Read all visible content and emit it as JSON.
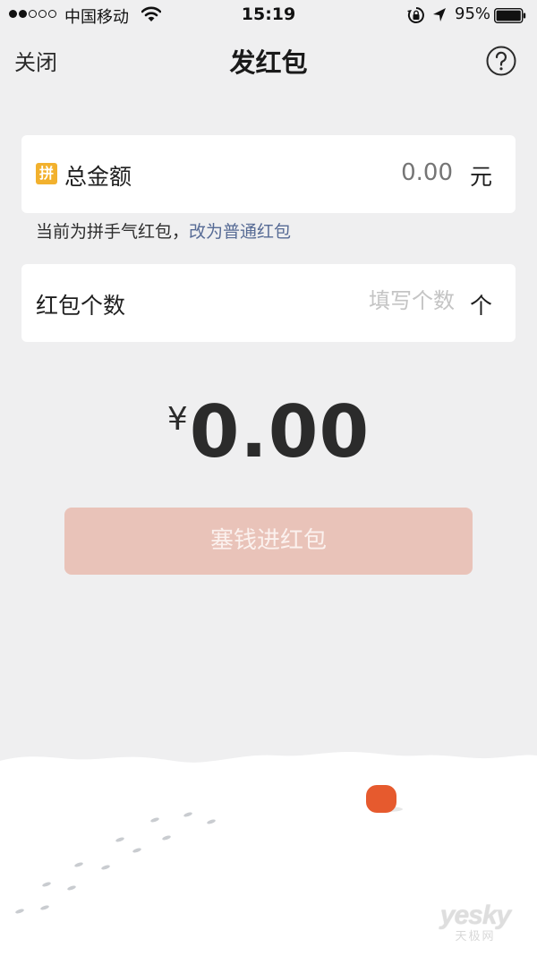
{
  "status_bar": {
    "carrier": "中国移动",
    "time": "15:19",
    "battery": "95%",
    "signal_bars_filled": 2,
    "signal_bars_total": 5
  },
  "nav": {
    "close": "关闭",
    "title": "发红包",
    "help_icon": "question-circle-icon"
  },
  "amount_card": {
    "badge": "拼",
    "label": "总金额",
    "value": "0.00",
    "unit": "元"
  },
  "hint": {
    "text": "当前为拼手气红包，",
    "link": "改为普通红包"
  },
  "count_card": {
    "label": "红包个数",
    "placeholder": "填写个数",
    "unit": "个"
  },
  "total": {
    "currency": "¥",
    "amount": "0.00"
  },
  "submit": {
    "label": "塞钱进红包"
  },
  "watermark": {
    "main": "yesky",
    "sub": "天极网"
  },
  "colors": {
    "background": "#efeff0",
    "card": "#ffffff",
    "link": "#576b95",
    "button_disabled": "#e9c3b9",
    "badge": "#f2b12e",
    "lantern": "#e65a2e"
  }
}
